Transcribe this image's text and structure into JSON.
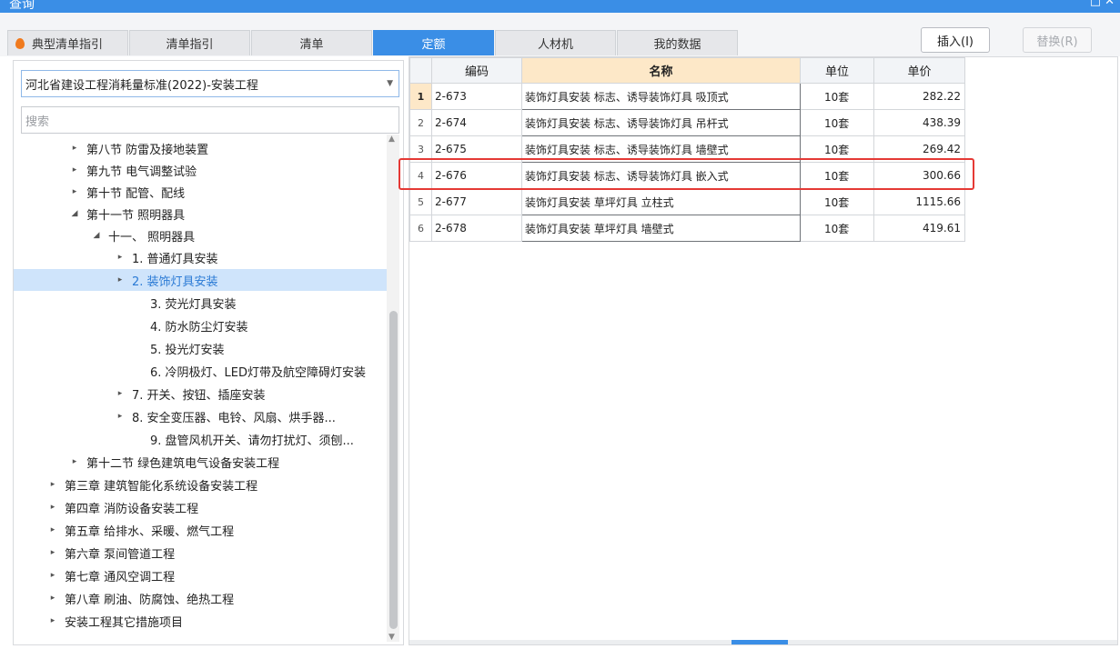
{
  "window": {
    "title": "查询",
    "controls": "□ ✕"
  },
  "tabs": [
    {
      "label": "典型清单指引"
    },
    {
      "label": "清单指引"
    },
    {
      "label": "清单"
    },
    {
      "label": "定额"
    },
    {
      "label": "人材机"
    },
    {
      "label": "我的数据"
    }
  ],
  "buttons": {
    "insert": "插入(I)",
    "replace": "替换(R)"
  },
  "left": {
    "standard": "河北省建设工程消耗量标准(2022)-安装工程",
    "search_placeholder": "搜索",
    "tree": [
      {
        "label": "第八节 防雷及接地装置",
        "toggle": "▸"
      },
      {
        "label": "第九节 电气调整试验",
        "toggle": "▸"
      },
      {
        "label": "第十节 配管、配线",
        "toggle": "▸"
      },
      {
        "label": "第十一节 照明器具",
        "toggle": "◢"
      },
      {
        "label": "十一、 照明器具",
        "toggle": "◢"
      },
      {
        "label": "1. 普通灯具安装",
        "toggle": "▸"
      },
      {
        "label": "2. 装饰灯具安装",
        "toggle": "▸"
      },
      {
        "label": "3. 荧光灯具安装",
        "toggle": ""
      },
      {
        "label": "4. 防水防尘灯安装",
        "toggle": ""
      },
      {
        "label": "5. 投光灯安装",
        "toggle": ""
      },
      {
        "label": "6. 冷阴极灯、LED灯带及航空障碍灯安装",
        "toggle": ""
      },
      {
        "label": "7. 开关、按钮、插座安装",
        "toggle": "▸"
      },
      {
        "label": "8. 安全变压器、电铃、风扇、烘手器...",
        "toggle": "▸"
      },
      {
        "label": "9. 盘管风机开关、请勿打扰灯、须刨...",
        "toggle": ""
      },
      {
        "label": "第十二节 绿色建筑电气设备安装工程",
        "toggle": "▸"
      },
      {
        "label": "第三章 建筑智能化系统设备安装工程",
        "toggle": "▸"
      },
      {
        "label": "第四章 消防设备安装工程",
        "toggle": "▸"
      },
      {
        "label": "第五章 给排水、采暖、燃气工程",
        "toggle": "▸"
      },
      {
        "label": "第六章 泵间管道工程",
        "toggle": "▸"
      },
      {
        "label": "第七章 通风空调工程",
        "toggle": "▸"
      },
      {
        "label": "第八章 刷油、防腐蚀、绝热工程",
        "toggle": "▸"
      },
      {
        "label": "安装工程其它措施项目",
        "toggle": "▸"
      }
    ]
  },
  "grid": {
    "headers": {
      "code": "编码",
      "name": "名称",
      "unit": "单位",
      "price": "单价"
    },
    "rows": [
      {
        "idx": "1",
        "code": "2-673",
        "name": "装饰灯具安装 标志、诱导装饰灯具 吸顶式",
        "unit": "10套",
        "price": "282.22"
      },
      {
        "idx": "2",
        "code": "2-674",
        "name": "装饰灯具安装 标志、诱导装饰灯具 吊杆式",
        "unit": "10套",
        "price": "438.39"
      },
      {
        "idx": "3",
        "code": "2-675",
        "name": "装饰灯具安装 标志、诱导装饰灯具 墙壁式",
        "unit": "10套",
        "price": "269.42"
      },
      {
        "idx": "4",
        "code": "2-676",
        "name": "装饰灯具安装 标志、诱导装饰灯具 嵌入式",
        "unit": "10套",
        "price": "300.66"
      },
      {
        "idx": "5",
        "code": "2-677",
        "name": "装饰灯具安装 草坪灯具 立柱式",
        "unit": "10套",
        "price": "1115.66"
      },
      {
        "idx": "6",
        "code": "2-678",
        "name": "装饰灯具安装 草坪灯具 墙壁式",
        "unit": "10套",
        "price": "419.61"
      }
    ]
  },
  "colors": {
    "accent": "#3a8ee6",
    "highlight_box": "#e53935",
    "selected_row": "#cfe4fb"
  }
}
